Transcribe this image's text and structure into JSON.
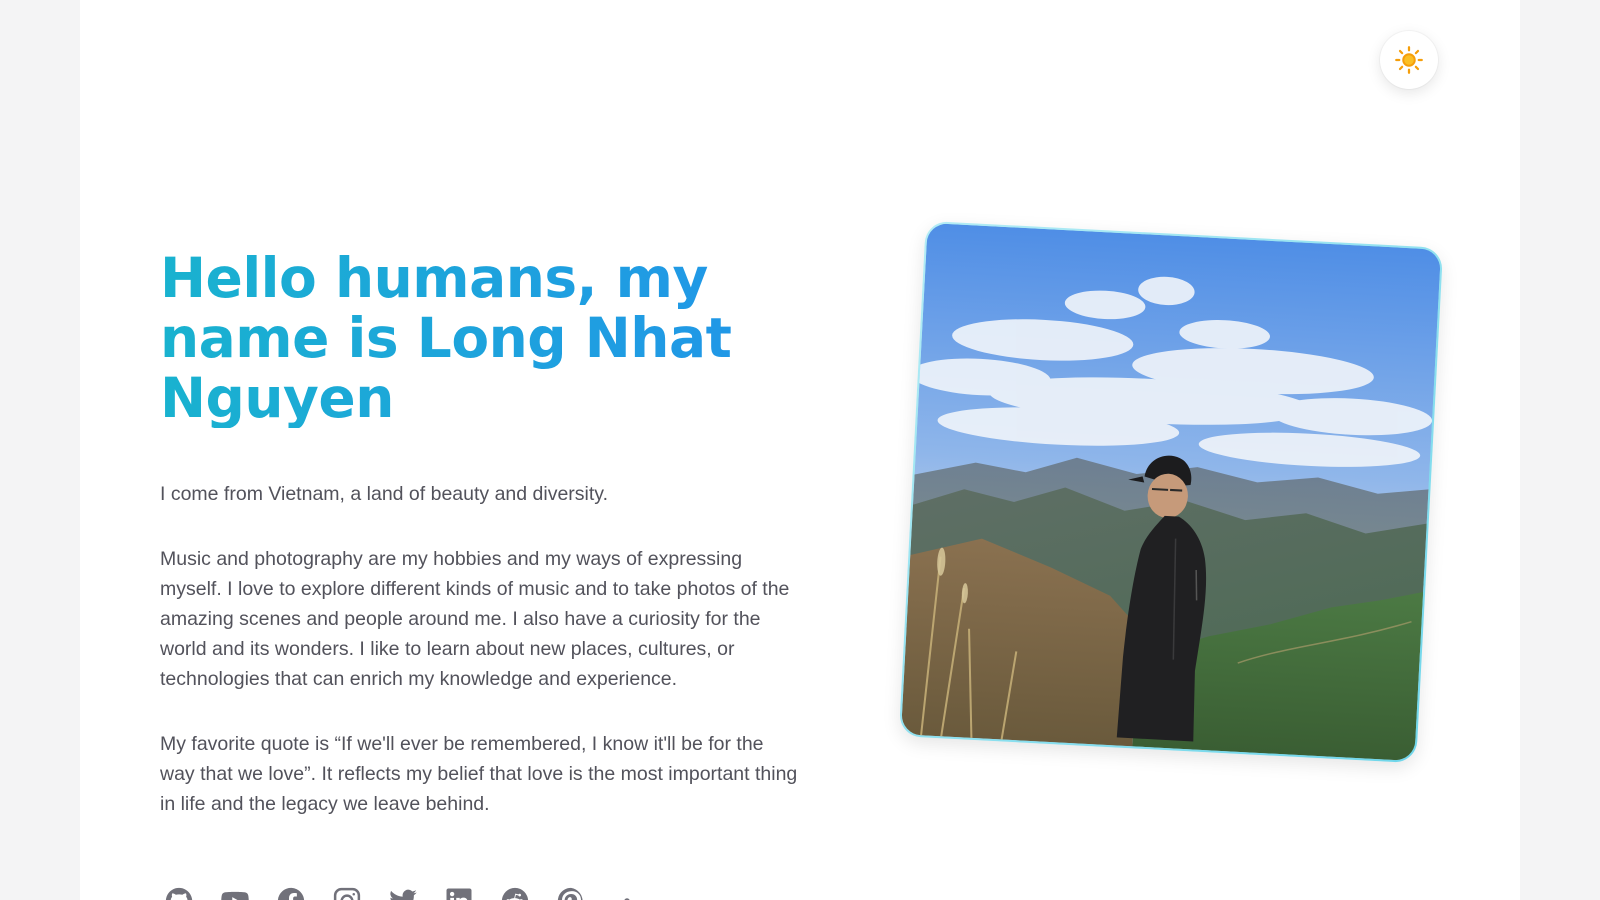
{
  "theme_toggle": {
    "icon": "sun-icon",
    "color": "#f59e0b"
  },
  "hero": {
    "headline": "Hello humans, my name is Long Nhat Nguyen",
    "paragraphs": [
      "I come from Vietnam, a land of beauty and diversity.",
      "Music and photography are my hobbies and my ways of expressing myself. I love to explore different kinds of music and to take photos of the amazing scenes and people around me. I also have a curiosity for the world and its wonders. I like to learn about new places, cultures, or technologies that can enrich my knowledge and experience.",
      "My favorite quote is “If we'll ever be remembered, I know it'll be for the way that we love”. It reflects my belief that love is the most important thing in life and the legacy we leave behind."
    ],
    "headline_gradient": [
      "#19b2cf",
      "#2196e8"
    ]
  },
  "socials": [
    {
      "icon": "github-icon"
    },
    {
      "icon": "youtube-icon"
    },
    {
      "icon": "facebook-icon"
    },
    {
      "icon": "instagram-icon"
    },
    {
      "icon": "twitter-icon"
    },
    {
      "icon": "linkedin-icon"
    },
    {
      "icon": "reddit-icon"
    },
    {
      "icon": "pinterest-icon"
    },
    {
      "icon": "more-icon"
    }
  ],
  "portrait": {
    "description_icon": "portrait-photo"
  },
  "colors": {
    "text": "#52525b",
    "icon": "#71717a",
    "border_accent": "#6fd6ea"
  }
}
